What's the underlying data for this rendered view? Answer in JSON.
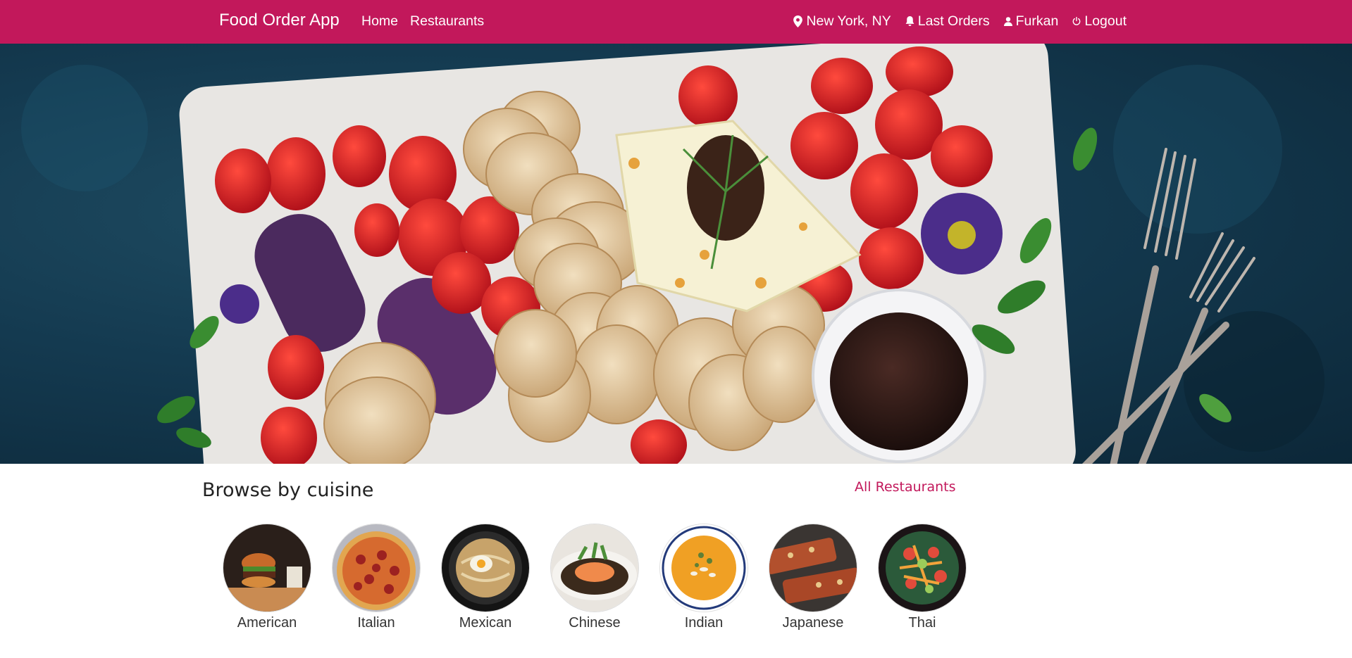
{
  "navbar": {
    "brand": "Food Order App",
    "links": [
      "Home",
      "Restaurants"
    ],
    "location": "New York, NY",
    "last_orders": "Last Orders",
    "user": "Furkan",
    "logout": "Logout"
  },
  "browse": {
    "title": "Browse by cuisine",
    "all_link": "All Restaurants"
  },
  "cuisines": [
    {
      "label": "American"
    },
    {
      "label": "Italian"
    },
    {
      "label": "Mexican"
    },
    {
      "label": "Chinese"
    },
    {
      "label": "Indian"
    },
    {
      "label": "Japanese"
    },
    {
      "label": "Thai"
    }
  ],
  "colors": {
    "brand": "#c2185b",
    "navbar_text": "#ffffff"
  },
  "icons": {
    "location": "map-pin-icon",
    "last_orders": "bell-icon",
    "user": "user-icon",
    "logout": "power-icon"
  }
}
